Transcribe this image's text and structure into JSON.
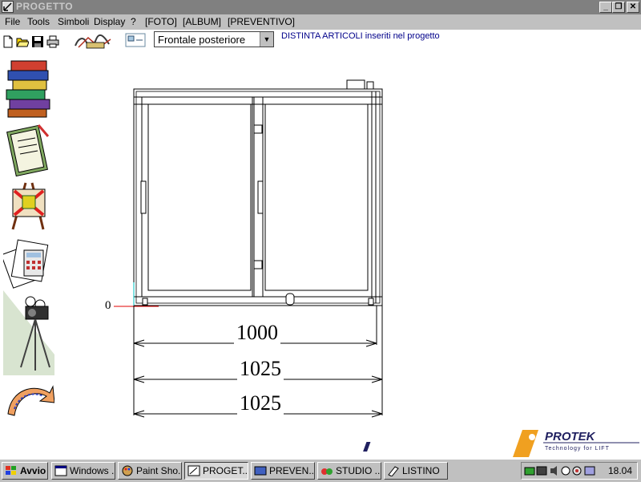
{
  "window": {
    "title": "PROGETTO",
    "min": "_",
    "restore": "❐",
    "close": "✕"
  },
  "menu": {
    "items": [
      "File",
      "Tools",
      "Simboli",
      "Display",
      "?",
      "[FOTO]",
      "[ALBUM]",
      "[PREVENTIVO]"
    ]
  },
  "toolbar": {
    "view_select": "Frontale posteriore",
    "distinta_link": "DISTINTA ARTICOLI inseriti nel progetto"
  },
  "sidebar": {
    "icons": [
      "books-icon",
      "clipboard-icon",
      "easel-icon",
      "calculator-icon",
      "camera-tripod-icon",
      "arrow-ribbon-icon"
    ]
  },
  "drawing": {
    "origin_label": "0",
    "dimensions": [
      "1000",
      "1025",
      "1025"
    ]
  },
  "logo": {
    "brand": "PROTEK",
    "tagline": "Technology for LIFT"
  },
  "taskbar": {
    "start": "Avvio",
    "buttons": [
      "Windows ...",
      "Paint Sho...",
      "PROGET...",
      "PREVEN...",
      "STUDIO ...",
      "LISTINO"
    ],
    "clock": "18.04"
  }
}
